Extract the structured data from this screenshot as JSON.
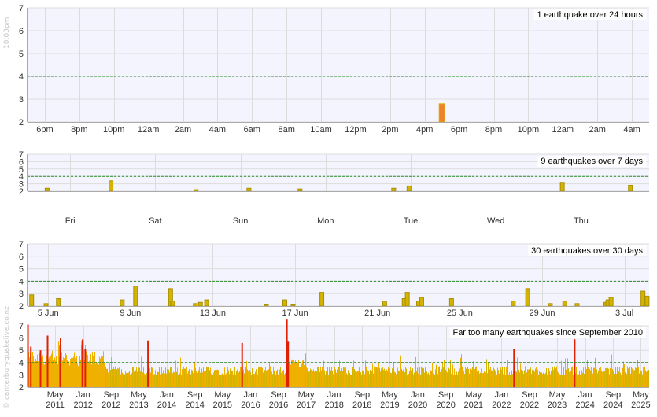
{
  "time_label": "10:03pm",
  "credit": "© canterburyquakelive.co.nz",
  "colors": {
    "bar_fill": "#d4b400",
    "bar_stroke": "#a88e00",
    "recent_fill": "#f0b000",
    "highlight_fill": "#f08030",
    "plot_bg": "#f4f4ff",
    "grid": "#dcdcdc",
    "threshold": "#2a8a2a",
    "tick_text": "#333333",
    "axis": "#aaaaaa",
    "mag5_fill": "#e02000"
  },
  "chart_data": [
    {
      "type": "bar",
      "title": "1 earthquake over 24 hours",
      "ylim": [
        2,
        7
      ],
      "yticks": [
        2,
        3,
        4,
        5,
        6,
        7
      ],
      "threshold": 4,
      "x_unit": "hours",
      "xlim": [
        -1,
        35
      ],
      "xticks": [
        {
          "x": 0,
          "label": "6pm"
        },
        {
          "x": 2,
          "label": "8pm"
        },
        {
          "x": 4,
          "label": "10pm"
        },
        {
          "x": 6,
          "label": "12am"
        },
        {
          "x": 8,
          "label": "2am"
        },
        {
          "x": 10,
          "label": "4am"
        },
        {
          "x": 12,
          "label": "6am"
        },
        {
          "x": 14,
          "label": "8am"
        },
        {
          "x": 16,
          "label": "10am"
        },
        {
          "x": 18,
          "label": "12pm"
        },
        {
          "x": 20,
          "label": "2pm"
        },
        {
          "x": 22,
          "label": "4pm"
        },
        {
          "x": 24,
          "label": "6pm"
        },
        {
          "x": 26,
          "label": "8pm"
        },
        {
          "x": 28,
          "label": "10pm"
        },
        {
          "x": 30,
          "label": "12am"
        },
        {
          "x": 32,
          "label": "2am"
        },
        {
          "x": 34,
          "label": "4am"
        }
      ],
      "bars": [
        {
          "x": 23.0,
          "mag": 2.8,
          "highlight": true
        }
      ]
    },
    {
      "type": "bar",
      "title": "9 earthquakes over 7 days",
      "ylim": [
        2,
        7
      ],
      "yticks": [
        2,
        3,
        4,
        5,
        6,
        7
      ],
      "threshold": 4,
      "x_unit": "days",
      "xlim": [
        0,
        7.3
      ],
      "xticks": [
        {
          "x": 0.5,
          "label": "Fri"
        },
        {
          "x": 1.5,
          "label": "Sat"
        },
        {
          "x": 2.5,
          "label": "Sun"
        },
        {
          "x": 3.5,
          "label": "Mon"
        },
        {
          "x": 4.5,
          "label": "Tue"
        },
        {
          "x": 5.5,
          "label": "Wed"
        },
        {
          "x": 6.5,
          "label": "Thu"
        }
      ],
      "bars": [
        {
          "x": 0.23,
          "mag": 2.4
        },
        {
          "x": 0.98,
          "mag": 3.4
        },
        {
          "x": 1.98,
          "mag": 2.2
        },
        {
          "x": 2.6,
          "mag": 2.4
        },
        {
          "x": 3.2,
          "mag": 2.3
        },
        {
          "x": 4.3,
          "mag": 2.4
        },
        {
          "x": 4.48,
          "mag": 2.7
        },
        {
          "x": 6.28,
          "mag": 3.2
        },
        {
          "x": 7.08,
          "mag": 2.8
        }
      ]
    },
    {
      "type": "bar",
      "title": "30 earthquakes over 30 days",
      "ylim": [
        2,
        7
      ],
      "yticks": [
        2,
        3,
        4,
        5,
        6,
        7
      ],
      "threshold": 4,
      "x_unit": "days",
      "xlim": [
        4,
        34.2
      ],
      "xticks": [
        {
          "x": 5,
          "label": "5 Jun"
        },
        {
          "x": 9,
          "label": "9 Jun"
        },
        {
          "x": 13,
          "label": "13 Jun"
        },
        {
          "x": 17,
          "label": "17 Jun"
        },
        {
          "x": 21,
          "label": "21 Jun"
        },
        {
          "x": 25,
          "label": "25 Jun"
        },
        {
          "x": 29,
          "label": "29 Jun"
        },
        {
          "x": 33,
          "label": "3 Jul"
        }
      ],
      "bars": [
        {
          "x": 4.2,
          "mag": 2.9
        },
        {
          "x": 4.9,
          "mag": 2.2
        },
        {
          "x": 5.5,
          "mag": 2.6
        },
        {
          "x": 8.6,
          "mag": 2.5
        },
        {
          "x": 9.25,
          "mag": 3.6
        },
        {
          "x": 10.95,
          "mag": 3.4
        },
        {
          "x": 11.05,
          "mag": 2.4
        },
        {
          "x": 12.15,
          "mag": 2.2
        },
        {
          "x": 12.4,
          "mag": 2.3
        },
        {
          "x": 12.7,
          "mag": 2.5
        },
        {
          "x": 15.6,
          "mag": 2.1
        },
        {
          "x": 16.5,
          "mag": 2.5
        },
        {
          "x": 16.9,
          "mag": 2.1
        },
        {
          "x": 18.3,
          "mag": 3.1
        },
        {
          "x": 21.35,
          "mag": 2.4
        },
        {
          "x": 22.3,
          "mag": 2.6
        },
        {
          "x": 22.45,
          "mag": 3.1
        },
        {
          "x": 23.0,
          "mag": 2.4
        },
        {
          "x": 23.15,
          "mag": 2.7
        },
        {
          "x": 24.6,
          "mag": 2.6
        },
        {
          "x": 27.6,
          "mag": 2.4
        },
        {
          "x": 28.3,
          "mag": 3.4
        },
        {
          "x": 29.4,
          "mag": 2.2
        },
        {
          "x": 30.1,
          "mag": 2.4
        },
        {
          "x": 30.7,
          "mag": 2.2
        },
        {
          "x": 32.1,
          "mag": 2.3
        },
        {
          "x": 32.2,
          "mag": 2.5
        },
        {
          "x": 32.35,
          "mag": 2.7
        },
        {
          "x": 33.9,
          "mag": 3.2
        },
        {
          "x": 34.1,
          "mag": 2.8
        }
      ]
    },
    {
      "type": "area",
      "title": "Far too many earthquakes since September 2010",
      "ylim": [
        2,
        7
      ],
      "yticks": [
        2,
        3,
        4,
        5,
        6,
        7
      ],
      "threshold": 4,
      "x_unit": "years",
      "xlim": [
        2010.67,
        2025.53
      ],
      "xticks": [
        {
          "x": 2011.33,
          "label": "May",
          "year": "2011"
        },
        {
          "x": 2012.0,
          "label": "Jan",
          "year": "2012"
        },
        {
          "x": 2012.67,
          "label": "Sep",
          "year": "2012"
        },
        {
          "x": 2013.33,
          "label": "May",
          "year": "2013"
        },
        {
          "x": 2014.0,
          "label": "Jan",
          "year": "2014"
        },
        {
          "x": 2014.67,
          "label": "Sep",
          "year": "2014"
        },
        {
          "x": 2015.33,
          "label": "May",
          "year": "2015"
        },
        {
          "x": 2016.0,
          "label": "Jan",
          "year": "2016"
        },
        {
          "x": 2016.67,
          "label": "Sep",
          "year": "2016"
        },
        {
          "x": 2017.33,
          "label": "May",
          "year": "2017"
        },
        {
          "x": 2018.0,
          "label": "Jan",
          "year": "2018"
        },
        {
          "x": 2018.67,
          "label": "Sep",
          "year": "2018"
        },
        {
          "x": 2019.33,
          "label": "May",
          "year": "2019"
        },
        {
          "x": 2020.0,
          "label": "Jan",
          "year": "2020"
        },
        {
          "x": 2020.67,
          "label": "Sep",
          "year": "2020"
        },
        {
          "x": 2021.33,
          "label": "May",
          "year": "2021"
        },
        {
          "x": 2022.0,
          "label": "Jan",
          "year": "2022"
        },
        {
          "x": 2022.67,
          "label": "Sep",
          "year": "2022"
        },
        {
          "x": 2023.33,
          "label": "May",
          "year": "2023"
        },
        {
          "x": 2024.0,
          "label": "Jan",
          "year": "2024"
        },
        {
          "x": 2024.67,
          "label": "Sep",
          "year": "2024"
        },
        {
          "x": 2025.33,
          "label": "May",
          "year": "2025"
        }
      ],
      "mag5_events": [
        {
          "x": 2010.68,
          "mag": 7.1
        },
        {
          "x": 2010.75,
          "mag": 5.3
        },
        {
          "x": 2010.98,
          "mag": 5.0
        },
        {
          "x": 2011.15,
          "mag": 6.2
        },
        {
          "x": 2011.45,
          "mag": 5.4
        },
        {
          "x": 2011.46,
          "mag": 6.0
        },
        {
          "x": 2011.98,
          "mag": 5.8
        },
        {
          "x": 2011.99,
          "mag": 5.9
        },
        {
          "x": 2012.05,
          "mag": 5.1
        },
        {
          "x": 2013.55,
          "mag": 5.8
        },
        {
          "x": 2015.8,
          "mag": 5.6
        },
        {
          "x": 2016.87,
          "mag": 7.5
        },
        {
          "x": 2016.9,
          "mag": 5.7
        },
        {
          "x": 2023.75,
          "mag": 5.9
        },
        {
          "x": 2022.3,
          "mag": 5.1
        }
      ]
    }
  ]
}
